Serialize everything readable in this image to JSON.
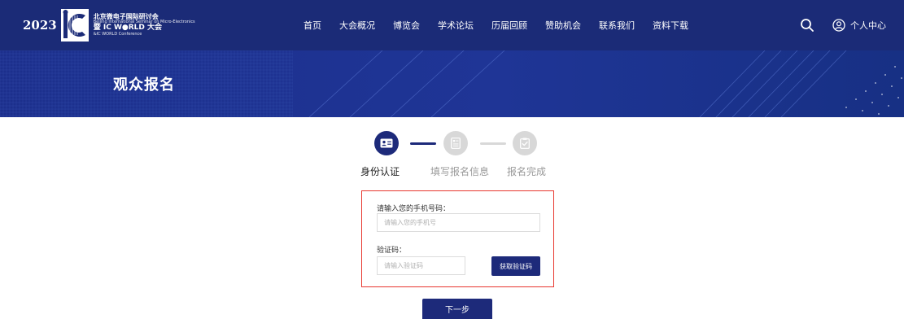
{
  "header": {
    "logo": {
      "year": "2023",
      "line1": "北京微电子国际研讨会",
      "line2": "Beijing International Seminar on Micro-Electronics",
      "line3": "暨 IC W●RLD 大会",
      "line4": "&IC WORLD Conference"
    },
    "nav": [
      "首页",
      "大会概况",
      "博览会",
      "学术论坛",
      "历届回顾",
      "赞助机会",
      "联系我们",
      "资料下载"
    ],
    "user_center": "个人中心",
    "icons": {
      "search": "search-icon",
      "user": "user-circle-icon"
    },
    "colors": {
      "header_bg": "#1b2b77"
    }
  },
  "banner": {
    "title": "观众报名",
    "colors": {
      "bg": "#1d3394"
    }
  },
  "steps": [
    {
      "label": "身份认证",
      "state": "active",
      "icon": "id-card-icon"
    },
    {
      "label": "填写报名信息",
      "state": "inactive",
      "icon": "form-icon"
    },
    {
      "label": "报名完成",
      "state": "inactive",
      "icon": "clipboard-check-icon"
    }
  ],
  "step_colors": {
    "active": "#1d2a7a",
    "inactive": "#d8d8d8",
    "inactive_text": "#999999"
  },
  "form": {
    "phone_label": "请输入您的手机号码：",
    "phone_placeholder": "请输入您的手机号",
    "phone_value": "",
    "code_label": "验证码：",
    "code_placeholder": "请输入验证码",
    "code_value": "",
    "sms_button": "获取验证码",
    "highlight_color": "#e8372f"
  },
  "actions": {
    "next": "下一步",
    "primary_color": "#1d2a7a"
  }
}
